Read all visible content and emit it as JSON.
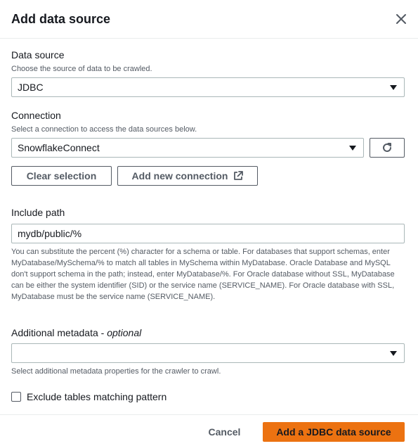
{
  "modal": {
    "title": "Add data source"
  },
  "data_source": {
    "label": "Data source",
    "description": "Choose the source of data to be crawled.",
    "selected": "JDBC"
  },
  "connection": {
    "label": "Connection",
    "description": "Select a connection to access the data sources below.",
    "selected": "SnowflakeConnect",
    "clear_label": "Clear selection",
    "add_label": "Add new connection"
  },
  "include_path": {
    "label": "Include path",
    "value": "mydb/public/%",
    "help": "You can substitute the percent (%) character for a schema or table. For databases that support schemas, enter MyDatabase/MySchema/% to match all tables in MySchema within MyDatabase. Oracle Database and MySQL don't support schema in the path; instead, enter MyDatabase/%. For Oracle database without SSL, MyDatabase can be either the system identifier (SID) or the service name (SERVICE_NAME). For Oracle database with SSL, MyDatabase must be the service name (SERVICE_NAME)."
  },
  "additional_metadata": {
    "label": "Additional metadata - ",
    "optional": "optional",
    "selected": "",
    "description": "Select additional metadata properties for the crawler to crawl."
  },
  "exclude": {
    "label": "Exclude tables matching pattern",
    "checked": false
  },
  "footer": {
    "cancel_label": "Cancel",
    "submit_label": "Add a JDBC data source"
  },
  "colors": {
    "primary": "#ec7211",
    "text": "#16191f",
    "secondary_text": "#545b64",
    "border": "#aab7b8"
  }
}
